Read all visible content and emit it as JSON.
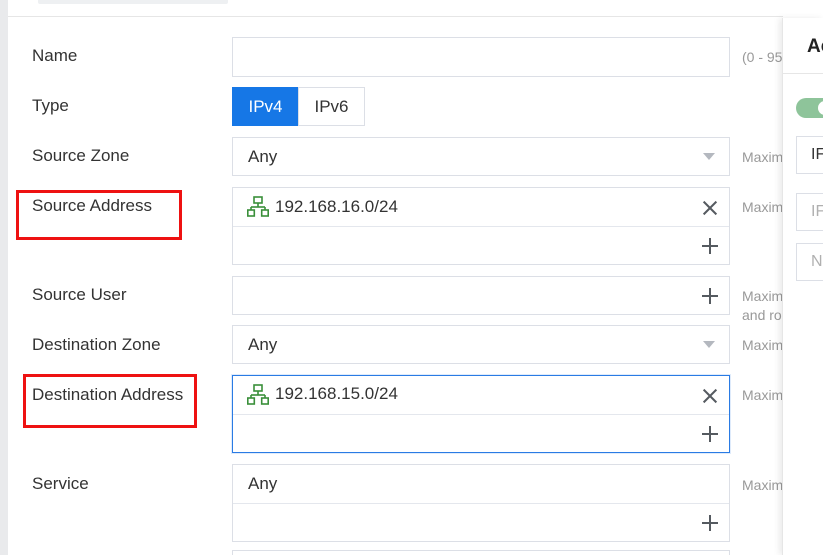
{
  "side_panel": {
    "title": "Ac",
    "field1": "IF",
    "field2": "IF",
    "field3": "N"
  },
  "form": {
    "name": {
      "label": "Name",
      "value": "",
      "hint": "(0 - 95"
    },
    "type": {
      "label": "Type",
      "options": [
        "IPv4",
        "IPv6"
      ],
      "selected": "IPv4"
    },
    "source_zone": {
      "label": "Source Zone",
      "value": "Any",
      "hint": "Maxim"
    },
    "source_address": {
      "label": "Source Address",
      "value": "192.168.16.0/24",
      "hint": "Maxim"
    },
    "source_user": {
      "label": "Source User",
      "value": "",
      "hint_line1": "Maxim",
      "hint_line2": "and ro"
    },
    "destination_zone": {
      "label": "Destination Zone",
      "value": "Any",
      "hint": "Maxim"
    },
    "destination_address": {
      "label": "Destination Address",
      "value": "192.168.15.0/24",
      "hint": "Maxim"
    },
    "service": {
      "label": "Service",
      "value": "Any",
      "hint": "Maxim"
    }
  },
  "icons": {
    "network": "network-icon",
    "remove": "close-icon",
    "add": "plus-icon",
    "dropdown": "chevron-down-icon"
  },
  "colors": {
    "primary": "#1677e6",
    "highlight": "#ee1111",
    "toggle_on": "#8ec49a",
    "network_icon": "#3a8f3a"
  }
}
